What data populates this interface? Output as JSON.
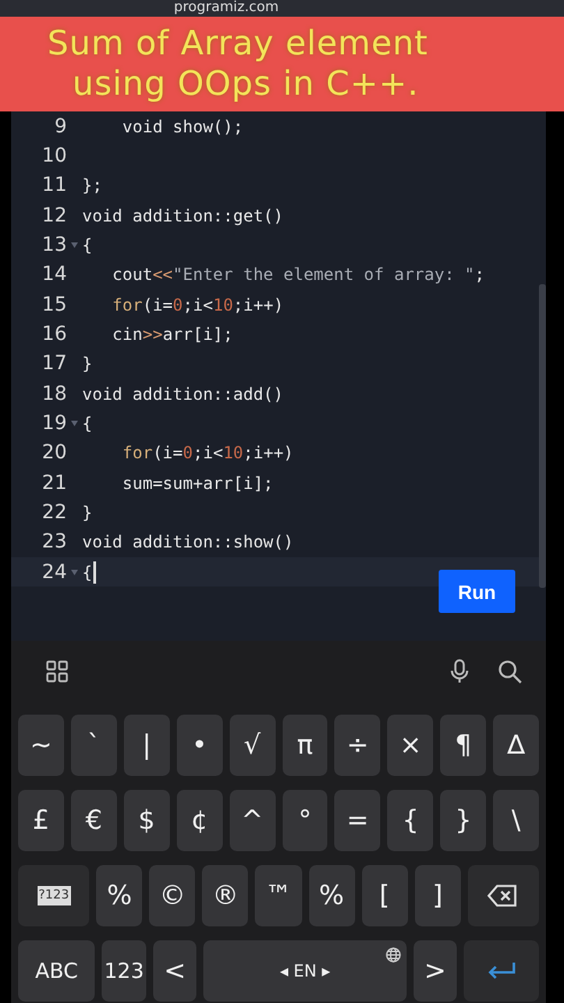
{
  "site": {
    "address": "programiz.com"
  },
  "banner": {
    "lines": [
      "Sum of Array element",
      "using OOps in C++."
    ]
  },
  "editor": {
    "lines": [
      {
        "number": "9",
        "foldable": false,
        "active": false,
        "tokens": [
          {
            "text": "    void show();",
            "kind": "plain"
          }
        ]
      },
      {
        "number": "10",
        "foldable": false,
        "active": false
      },
      {
        "number": "11",
        "foldable": false,
        "active": false,
        "tokens": [
          {
            "text": "};",
            "kind": "plain"
          }
        ]
      },
      {
        "number": "12",
        "foldable": false,
        "active": false,
        "tokens": [
          {
            "text": "void addition::get()",
            "kind": "plain"
          }
        ]
      },
      {
        "number": "13",
        "foldable": true,
        "active": false,
        "tokens": [
          {
            "text": "{",
            "kind": "plain"
          }
        ]
      },
      {
        "number": "14",
        "foldable": false,
        "active": false,
        "tokens": [
          {
            "text": "   cout",
            "kind": "plain"
          },
          {
            "text": "<<",
            "kind": "operator"
          },
          {
            "text": "\"Enter the element of array: \"",
            "kind": "string"
          },
          {
            "text": ";",
            "kind": "plain"
          }
        ]
      },
      {
        "number": "15",
        "foldable": false,
        "active": false,
        "tokens": [
          {
            "text": "   for",
            "kind": "keyword"
          },
          {
            "text": "(i=",
            "kind": "plain"
          },
          {
            "text": "0",
            "kind": "number"
          },
          {
            "text": ";i<",
            "kind": "plain"
          },
          {
            "text": "10",
            "kind": "number"
          },
          {
            "text": ";i++)",
            "kind": "plain"
          }
        ]
      },
      {
        "number": "16",
        "foldable": false,
        "active": false,
        "tokens": [
          {
            "text": "   cin",
            "kind": "plain"
          },
          {
            "text": ">>",
            "kind": "operator"
          },
          {
            "text": "arr[i];",
            "kind": "plain"
          }
        ]
      },
      {
        "number": "17",
        "foldable": false,
        "active": false,
        "tokens": [
          {
            "text": "}",
            "kind": "plain"
          }
        ]
      },
      {
        "number": "18",
        "foldable": false,
        "active": false,
        "tokens": [
          {
            "text": "void addition::add()",
            "kind": "plain"
          }
        ]
      },
      {
        "number": "19",
        "foldable": true,
        "active": false,
        "tokens": [
          {
            "text": "{",
            "kind": "plain"
          }
        ]
      },
      {
        "number": "20",
        "foldable": false,
        "active": false,
        "tokens": [
          {
            "text": "    for",
            "kind": "keyword"
          },
          {
            "text": "(i=",
            "kind": "plain"
          },
          {
            "text": "0",
            "kind": "number"
          },
          {
            "text": ";i<",
            "kind": "plain"
          },
          {
            "text": "10",
            "kind": "number"
          },
          {
            "text": ";i++)",
            "kind": "plain"
          }
        ]
      },
      {
        "number": "21",
        "foldable": false,
        "active": false,
        "tokens": [
          {
            "text": "    sum=sum+arr[i];",
            "kind": "plain"
          }
        ]
      },
      {
        "number": "22",
        "foldable": false,
        "active": false,
        "tokens": [
          {
            "text": "}",
            "kind": "plain"
          }
        ]
      },
      {
        "number": "23",
        "foldable": false,
        "active": false,
        "tokens": [
          {
            "text": "void addition::show()",
            "kind": "plain"
          }
        ]
      },
      {
        "number": "24",
        "foldable": true,
        "active": true,
        "tokens": [
          {
            "text": "{",
            "kind": "plain"
          }
        ]
      }
    ],
    "run_button": "Run"
  },
  "keyboard": {
    "rows": [
      {
        "keys": [
          {
            "label": "~",
            "kind": "char"
          },
          {
            "label": "`",
            "kind": "char"
          },
          {
            "label": "|",
            "kind": "char"
          },
          {
            "label": "•",
            "kind": "char"
          },
          {
            "label": "√",
            "kind": "char"
          },
          {
            "label": "π",
            "kind": "char"
          },
          {
            "label": "÷",
            "kind": "char"
          },
          {
            "label": "×",
            "kind": "char"
          },
          {
            "label": "¶",
            "kind": "char"
          },
          {
            "label": "∆",
            "kind": "char"
          }
        ]
      },
      {
        "keys": [
          {
            "label": "£",
            "kind": "char"
          },
          {
            "label": "€",
            "kind": "char"
          },
          {
            "label": "$",
            "kind": "char"
          },
          {
            "label": "¢",
            "kind": "char"
          },
          {
            "label": "^",
            "kind": "char"
          },
          {
            "label": "°",
            "kind": "char"
          },
          {
            "label": "=",
            "kind": "char"
          },
          {
            "label": "{",
            "kind": "char"
          },
          {
            "label": "}",
            "kind": "char"
          },
          {
            "label": "\\",
            "kind": "char"
          }
        ]
      },
      {
        "keys": [
          {
            "label": "?123",
            "kind": "mode"
          },
          {
            "label": "%",
            "kind": "char"
          },
          {
            "label": "©",
            "kind": "char"
          },
          {
            "label": "®",
            "kind": "char"
          },
          {
            "label": "™",
            "kind": "char"
          },
          {
            "label": "%",
            "kind": "char"
          },
          {
            "label": "[",
            "kind": "char"
          },
          {
            "label": "]",
            "kind": "char"
          },
          {
            "kind": "backspace"
          }
        ]
      },
      {
        "keys": [
          {
            "label": "ABC",
            "kind": "wide"
          },
          {
            "label": "123",
            "kind": "label"
          },
          {
            "label": "<",
            "kind": "char"
          },
          {
            "label": "◂ EN ▸",
            "kind": "space"
          },
          {
            "label": ">",
            "kind": "char"
          },
          {
            "kind": "enter"
          }
        ]
      }
    ]
  }
}
